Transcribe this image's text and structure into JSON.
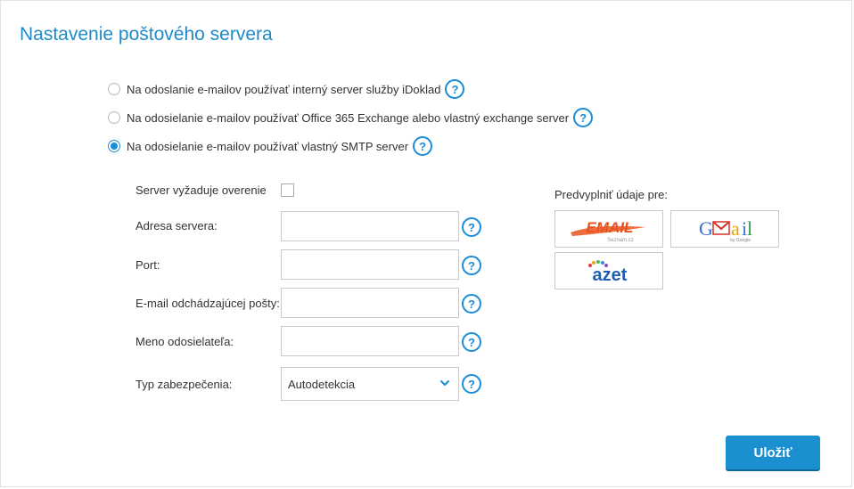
{
  "page": {
    "title": "Nastavenie poštového servera"
  },
  "options": [
    {
      "label": "Na odoslanie e-mailov používať interný server služby iDoklad",
      "checked": false
    },
    {
      "label": "Na odosielanie e-mailov používať Office 365 Exchange alebo vlastný exchange server",
      "checked": false
    },
    {
      "label": "Na odosielanie e-mailov používať vlastný SMTP server",
      "checked": true
    }
  ],
  "form": {
    "auth_label": "Server vyžaduje overenie",
    "auth_checked": false,
    "server_label": "Adresa servera:",
    "server_value": "",
    "port_label": "Port:",
    "port_value": "",
    "email_label": "E-mail odchádzajúcej pošty:",
    "email_value": "",
    "sender_label": "Meno odosielateľa:",
    "sender_value": "",
    "security_label": "Typ zabezpečenia:",
    "security_value": "Autodetekcia"
  },
  "help_glyph": "?",
  "prefill": {
    "label": "Predvyplniť údaje pre:",
    "providers": [
      {
        "name": "EMAIL",
        "sub": "Seznam.cz"
      },
      {
        "name": "Gmail",
        "sub": "by Google"
      },
      {
        "name": "azet"
      }
    ]
  },
  "actions": {
    "save_label": "Uložiť"
  },
  "colors": {
    "accent": "#1a8cd8",
    "title": "#1f8ac8",
    "email_logo": "#e8531f"
  }
}
